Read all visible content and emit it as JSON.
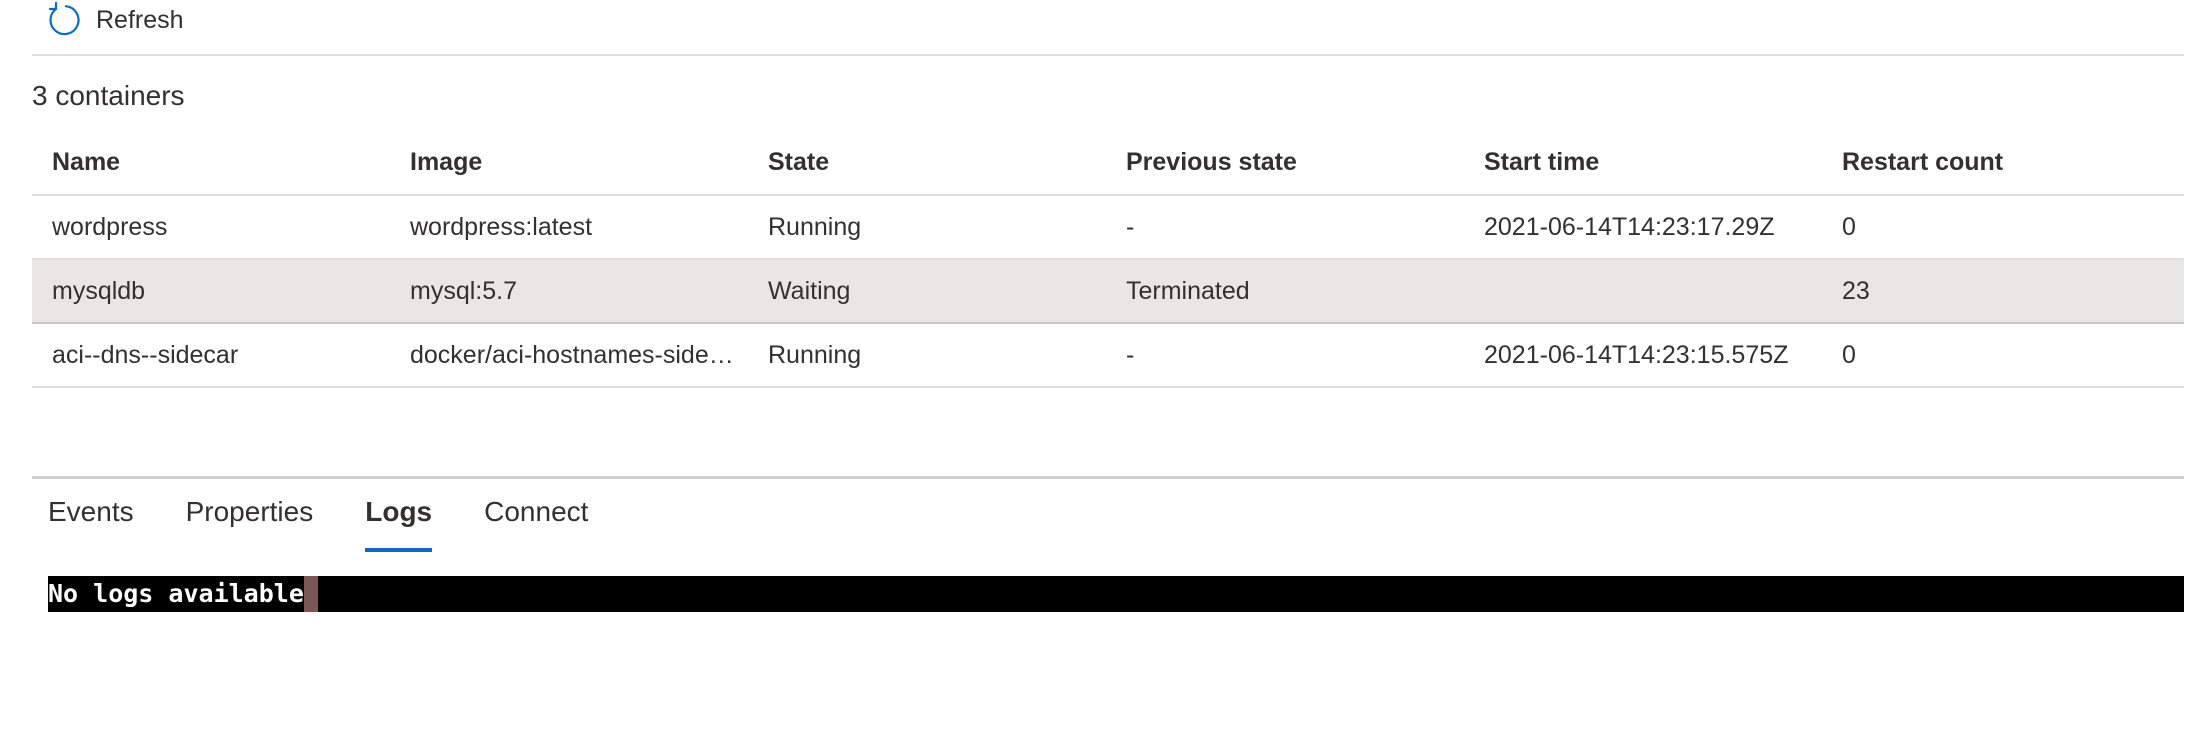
{
  "toolbar": {
    "refresh_label": "Refresh",
    "refresh_icon": "refresh-icon"
  },
  "container_count": "3 containers",
  "table": {
    "columns": [
      "Name",
      "Image",
      "State",
      "Previous state",
      "Start time",
      "Restart count"
    ],
    "rows": [
      [
        "wordpress",
        "wordpress:latest",
        "Running",
        "-",
        "2021-06-14T14:23:17.29Z",
        "0"
      ],
      [
        "mysqldb",
        "mysql:5.7",
        "Waiting",
        "Terminated",
        "",
        "23"
      ],
      [
        "aci--dns--sidecar",
        "docker/aci-hostnames-side…",
        "Running",
        "-",
        "2021-06-14T14:23:15.575Z",
        "0"
      ]
    ],
    "selected_row": 1
  },
  "tabs": [
    "Events",
    "Properties",
    "Logs",
    "Connect"
  ],
  "active_tab": "Logs",
  "console": {
    "text": "No logs available"
  },
  "colors": {
    "accent": "#0f6cbd",
    "selected_row": "#e8e7e6",
    "console_bg": "#000000",
    "console_fg": "#ffffff"
  }
}
